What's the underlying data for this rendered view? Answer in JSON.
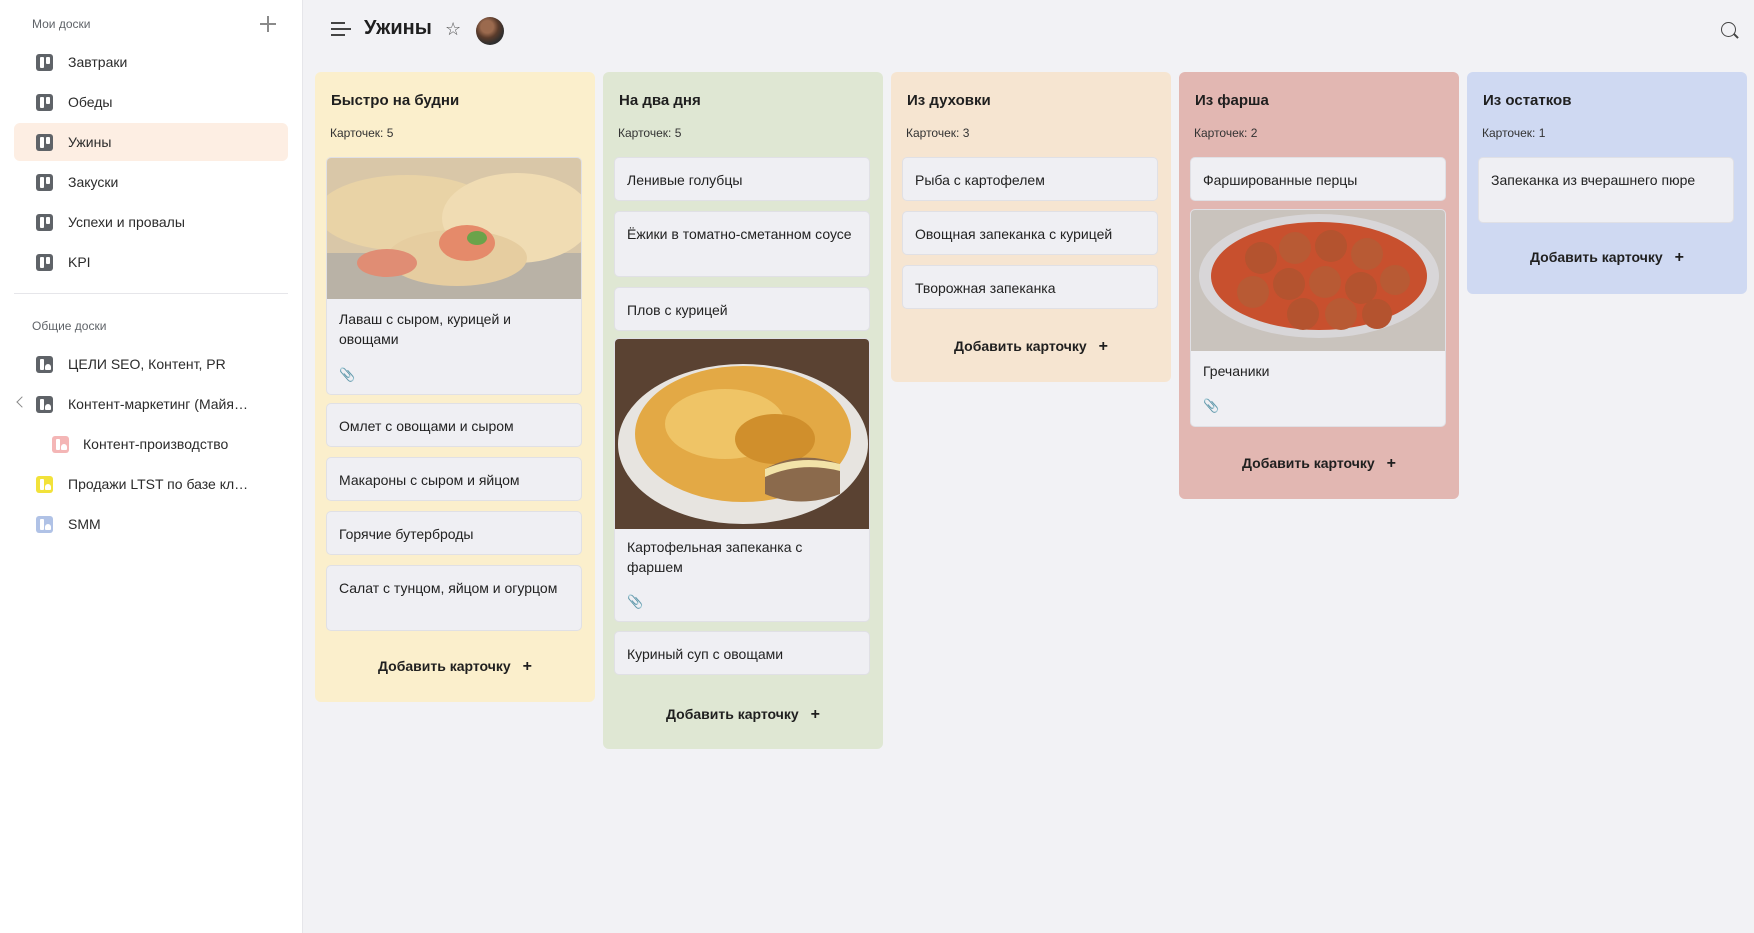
{
  "sidebar": {
    "my_boards_title": "Мои доски",
    "shared_boards_title": "Общие доски",
    "my_boards": [
      {
        "label": "Завтраки",
        "icon": "board-icon"
      },
      {
        "label": "Обеды",
        "icon": "board-icon"
      },
      {
        "label": "Ужины",
        "icon": "board-icon",
        "active": true
      },
      {
        "label": "Закуски",
        "icon": "board-icon"
      },
      {
        "label": "Успехи и провалы",
        "icon": "board-icon"
      },
      {
        "label": "KPI",
        "icon": "board-icon"
      }
    ],
    "shared_boards": [
      {
        "label": "ЦЕЛИ SEO, Контент, PR",
        "icon": "shared-board-icon"
      },
      {
        "label": "Контент-маркетинг (Майя…",
        "icon": "shared-board-icon"
      },
      {
        "label": "Контент-производство",
        "icon": "shared-board-icon",
        "color": "#f4b6b6"
      },
      {
        "label": "Продажи LTST по базе кл…",
        "icon": "shared-board-icon",
        "color": "#f2e23a"
      },
      {
        "label": "SMM",
        "icon": "shared-board-icon",
        "color": "#b0c2e6"
      }
    ]
  },
  "header": {
    "title": "Ужины"
  },
  "add_card_label": "Добавить карточку",
  "add_card_plus": "+",
  "columns": [
    {
      "title": "Быстро на будни",
      "count": "Карточек: 5",
      "color": "#fbefcc",
      "cards": [
        {
          "title": "Лаваш с сыром, курицей и овощами",
          "has_image": true,
          "has_attachment": true
        },
        {
          "title": "Омлет с овощами и сыром"
        },
        {
          "title": "Макароны с сыром и яйцом"
        },
        {
          "title": "Горячие бутерброды"
        },
        {
          "title": "Салат с тунцом, яйцом и огурцом"
        }
      ]
    },
    {
      "title": "На два дня",
      "count": "Карточек: 5",
      "color": "#dfe7d3",
      "cards": [
        {
          "title": "Ленивые голубцы"
        },
        {
          "title": "Ёжики в томатно-сметанном соусе"
        },
        {
          "title": "Плов с курицей"
        },
        {
          "title": "Картофельная запеканка с фаршем",
          "has_image": true,
          "has_attachment": true
        },
        {
          "title": "Куриный суп с овощами"
        }
      ]
    },
    {
      "title": "Из духовки",
      "count": "Карточек: 3",
      "color": "#f6e5d1",
      "cards": [
        {
          "title": "Рыба с картофелем"
        },
        {
          "title": "Овощная запеканка с курицей"
        },
        {
          "title": "Творожная запеканка"
        }
      ]
    },
    {
      "title": "Из фарша",
      "count": "Карточек: 2",
      "color": "#e2b7b2",
      "cards": [
        {
          "title": "Фаршированные перцы"
        },
        {
          "title": "Гречаники",
          "has_image": true,
          "has_attachment": true
        }
      ]
    },
    {
      "title": "Из остатков",
      "count": "Карточек: 1",
      "color": "#cfd9f2",
      "cards": [
        {
          "title": "Запеканка из вчерашнего пюре"
        }
      ]
    }
  ]
}
